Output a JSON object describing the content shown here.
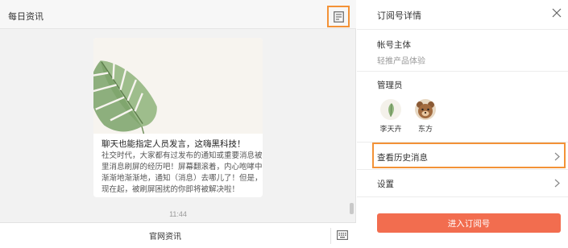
{
  "chat": {
    "title": "每日资讯",
    "card": {
      "title": "聊天也能指定人员发言，这嗨黑科技！",
      "body_lines": [
        "社交时代，大家都有过发布的通知或重要消息被群",
        "里消息刷屏的经历吧！屏幕翻滚着，内心咆哮中，",
        "渐渐地渐渐地，通知（消息）去哪儿了！但是，从",
        "现在起，被刷屏困扰的你即将被解决啦！"
      ]
    },
    "time": "11:44",
    "footer_menu": "官网资讯"
  },
  "detail": {
    "title": "订阅号详情",
    "account_label": "帐号主体",
    "account_value": "轻推产品体验",
    "admins_label": "管理员",
    "admins": [
      {
        "name": "李天卉"
      },
      {
        "name": "东方"
      }
    ],
    "history_label": "查看历史消息",
    "settings_label": "设置",
    "enter_button": "进入订阅号"
  },
  "colors": {
    "accent_orange": "#f39237",
    "primary_button": "#f26d4f"
  },
  "icons": {
    "doc": "document-icon",
    "close": "close-icon",
    "chevron": "chevron-right-icon",
    "keyboard": "keyboard-icon"
  }
}
